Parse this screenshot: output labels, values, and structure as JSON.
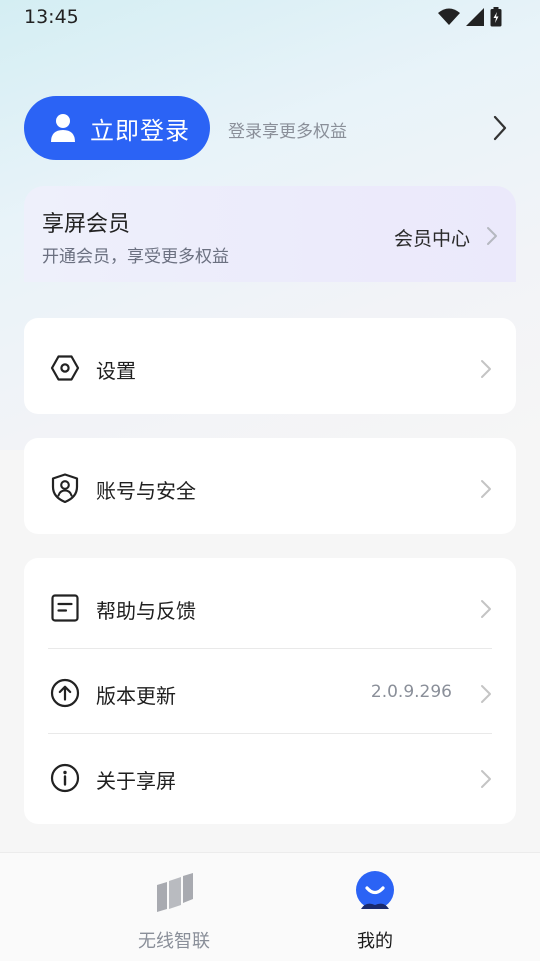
{
  "status_bar": {
    "time": "13:45"
  },
  "login": {
    "button_label": "立即登录",
    "subtitle": "登录享更多权益"
  },
  "vip": {
    "title": "享屏会员",
    "subtitle": "开通会员，享受更多权益",
    "center_label": "会员中心"
  },
  "menu": {
    "settings": "设置",
    "account_security": "账号与安全",
    "help_feedback": "帮助与反馈",
    "version_update": "版本更新",
    "version_value": "2.0.9.296",
    "about": "关于享屏"
  },
  "bottom_nav": {
    "items": [
      {
        "label": "无线智联",
        "icon": "cast-screens-icon",
        "active": false
      },
      {
        "label": "我的",
        "icon": "profile-face-icon",
        "active": true
      }
    ]
  },
  "colors": {
    "accent": "#2b63f5",
    "text_primary": "#1f1f1f",
    "text_secondary": "#8a8f99",
    "inactive_nav": "#8a8f99"
  }
}
